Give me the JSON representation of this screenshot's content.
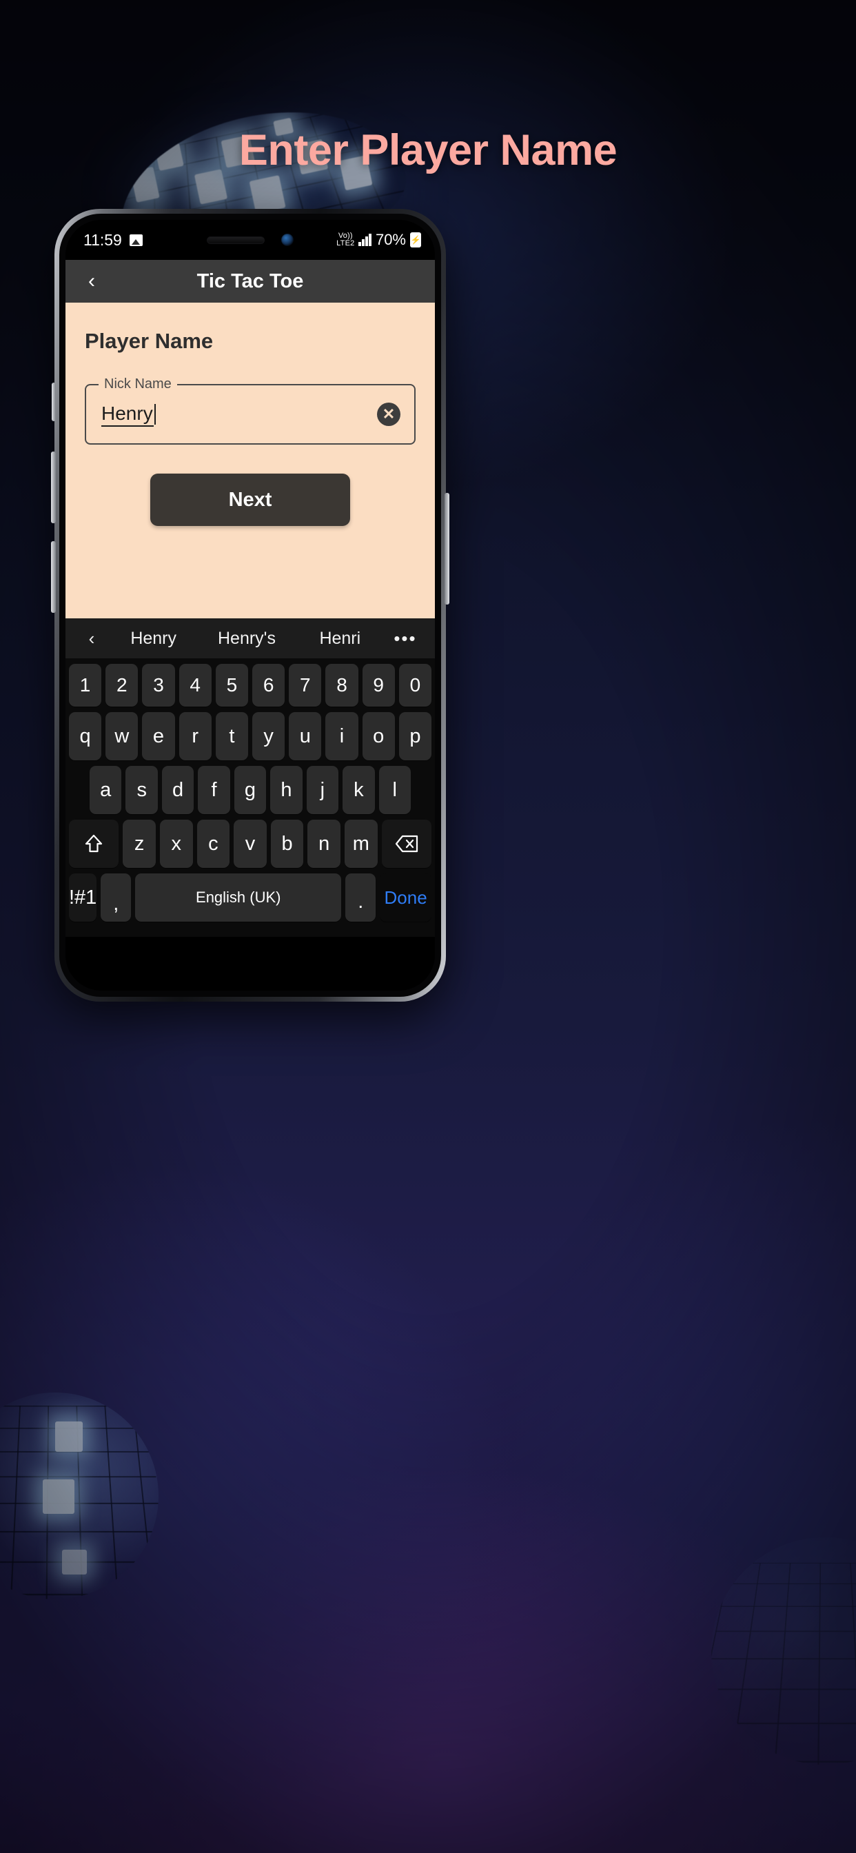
{
  "page": {
    "headline": "Enter Player Name"
  },
  "status_bar": {
    "time": "11:59",
    "photo_icon": "photo-icon",
    "network_label_top": "Vo))",
    "network_label_bottom": "LTE2",
    "battery_text": "70%",
    "battery_icon": "battery-charging-icon"
  },
  "app_bar": {
    "back_icon": "chevron-left-icon",
    "title": "Tic Tac Toe"
  },
  "form": {
    "heading": "Player Name",
    "field_label": "Nick Name",
    "field_value": "Henry",
    "field_placeholder": "Nick Name",
    "clear_icon": "clear-circle-icon",
    "next_label": "Next"
  },
  "keyboard": {
    "suggestions": {
      "back_icon": "chevron-left-icon",
      "items": [
        "Henry",
        "Henry's",
        "Henri"
      ],
      "more_icon": "overflow-dots-icon"
    },
    "rows": {
      "numbers": [
        "1",
        "2",
        "3",
        "4",
        "5",
        "6",
        "7",
        "8",
        "9",
        "0"
      ],
      "qwerty": [
        "q",
        "w",
        "e",
        "r",
        "t",
        "y",
        "u",
        "i",
        "o",
        "p"
      ],
      "asdf": [
        "a",
        "s",
        "d",
        "f",
        "g",
        "h",
        "j",
        "k",
        "l"
      ],
      "zxcv": [
        "z",
        "x",
        "c",
        "v",
        "b",
        "n",
        "m"
      ]
    },
    "shift_icon": "shift-arrow-icon",
    "backspace_icon": "backspace-icon",
    "symbols_label": "!#1",
    "comma_label": ",",
    "space_label": "English (UK)",
    "period_label": ".",
    "done_label": "Done"
  },
  "colors": {
    "headline": "#fca9a0",
    "app_surface": "#fbddc2",
    "app_bar": "#3b3b3b",
    "button": "#3b3733",
    "done_accent": "#2f7df6",
    "keyboard_bg": "#0b0b0b",
    "key_bg": "#2c2c2c"
  }
}
